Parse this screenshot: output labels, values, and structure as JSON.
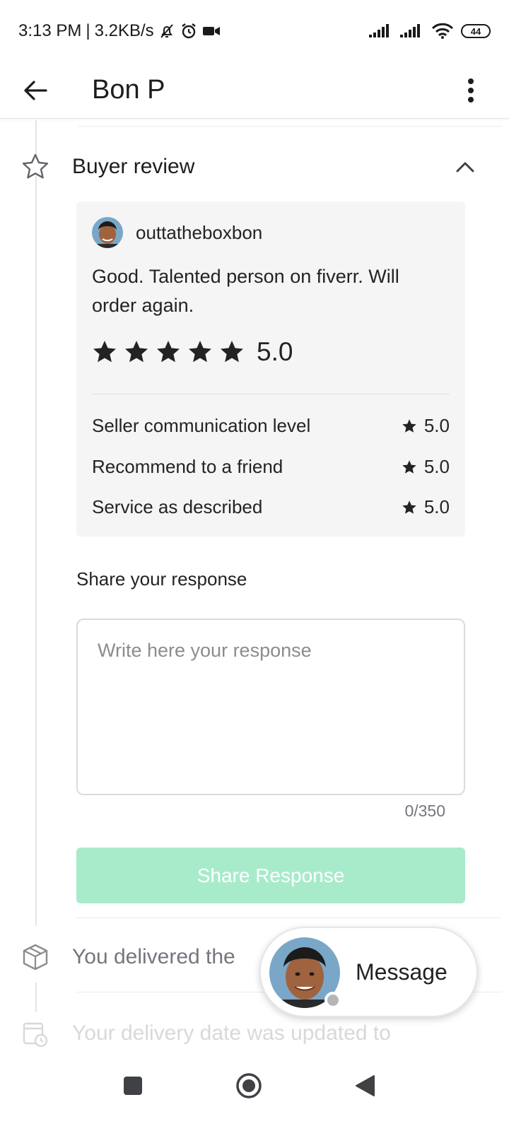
{
  "status_bar": {
    "time": "3:13 PM",
    "separator": "|",
    "speed": "3.2KB/s",
    "battery": "44"
  },
  "app_bar": {
    "title": "Bon P"
  },
  "buyer_review": {
    "section_title": "Buyer review",
    "reviewer_name": "outtatheboxbon",
    "review_text": "Good. Talented person on fiverr. Will order again.",
    "overall_stars": 5,
    "overall_score": "5.0",
    "sub_ratings": [
      {
        "label": "Seller communication level",
        "score": "5.0"
      },
      {
        "label": "Recommend to a friend",
        "score": "5.0"
      },
      {
        "label": "Service as described",
        "score": "5.0"
      }
    ]
  },
  "response": {
    "title": "Share your response",
    "placeholder": "Write here your response",
    "value": "",
    "char_count": "0/350",
    "button_label": "Share Response"
  },
  "activity": {
    "delivered_text": "You delivered the",
    "delivery_date_text": "Your delivery date was updated to"
  },
  "message_fab": {
    "label": "Message"
  },
  "colors": {
    "accent_disabled": "#a8ebcb",
    "text_primary": "#222325",
    "text_secondary": "#74767e",
    "card_bg": "#f5f5f5"
  }
}
